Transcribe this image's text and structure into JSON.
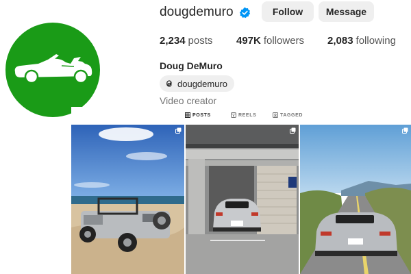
{
  "profile": {
    "username": "dougdemuro",
    "verified": true,
    "follow_label": "Follow",
    "message_label": "Message",
    "full_name": "Doug DeMuro",
    "threads_handle": "dougdemuro",
    "category": "Video creator",
    "avatar_color": "#1a9b17",
    "avatar_icon": "car-silhouette-icon"
  },
  "stats": {
    "posts_value": "2,234",
    "posts_label": "posts",
    "followers_value": "497K",
    "followers_label": "followers",
    "following_value": "2,083",
    "following_label": "following"
  },
  "tabs": [
    {
      "label": "POSTS",
      "icon": "grid-icon",
      "active": true
    },
    {
      "label": "REELS",
      "icon": "reels-icon",
      "active": false
    },
    {
      "label": "TAGGED",
      "icon": "tagged-icon",
      "active": false
    }
  ],
  "posts": [
    {
      "subject": "silver convertible off-roader on a beach",
      "plate": "",
      "multi": true
    },
    {
      "subject": "silver supercar parked in a garage",
      "plate": "",
      "multi": true
    },
    {
      "subject": "silver supercar on a coastal road",
      "plate": "",
      "multi": true
    }
  ],
  "colors": {
    "verified_blue": "#0095f6",
    "button_bg": "#efefef",
    "text": "#262626",
    "muted": "#737373"
  }
}
